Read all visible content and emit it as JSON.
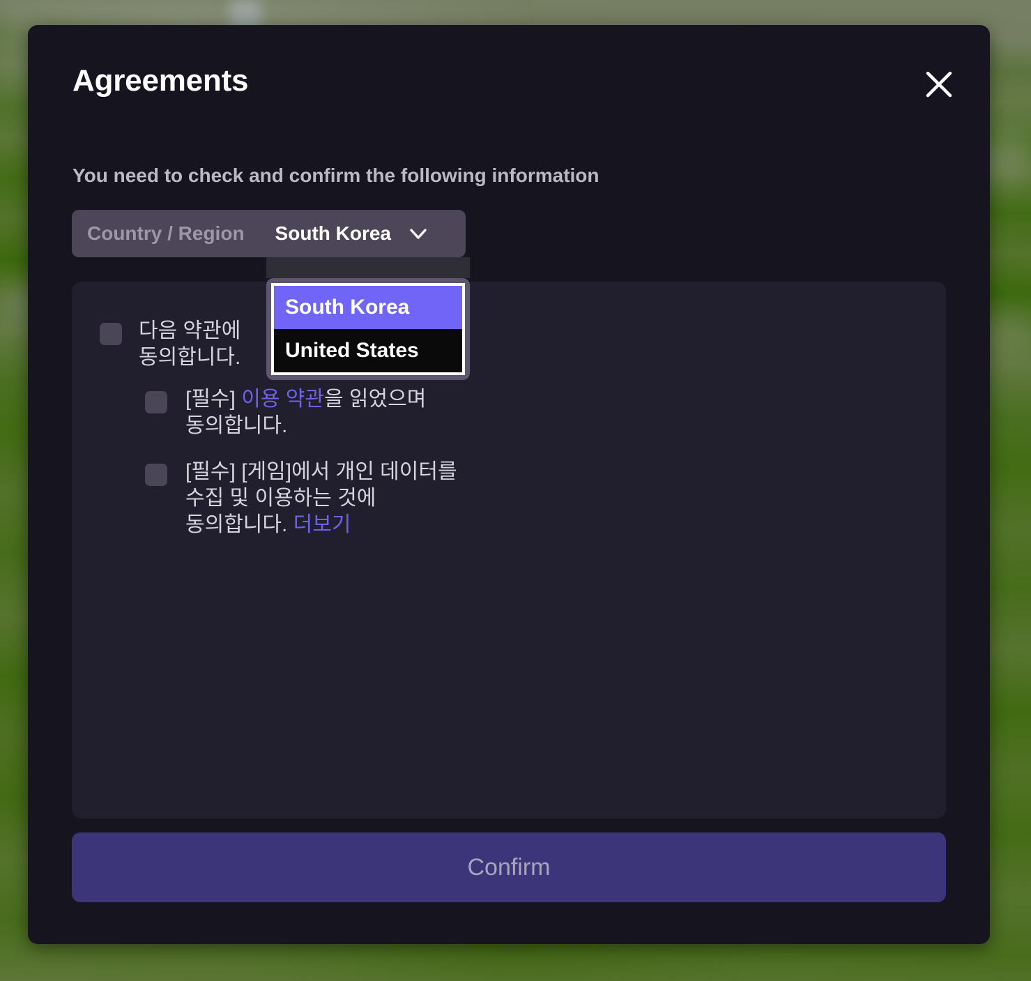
{
  "dialog": {
    "title": "Agreements",
    "subtitle": "You need to check and confirm the following information",
    "close_icon": "close-icon"
  },
  "country_select": {
    "label": "Country / Region",
    "value": "South Korea",
    "caret_icon": "chevron-down-icon",
    "expanded": true,
    "options": [
      {
        "label": "South Korea",
        "selected": true
      },
      {
        "label": "United States",
        "selected": false
      }
    ]
  },
  "agreements": [
    {
      "id": "agree-all",
      "checked": false,
      "text": "다음 약관에\n동의합니다.",
      "link_text": "",
      "link_position": ""
    },
    {
      "id": "agree-tos",
      "checked": false,
      "prefix": "[필수] ",
      "link_text": "이용 약관",
      "suffix": "을 읽었으며\n동의합니다."
    },
    {
      "id": "agree-data",
      "checked": false,
      "prefix": "[필수] [게임]에서 개인 데이터를\n수집 및 이용하는 것에\n동의합니다. ",
      "link_text": "더보기",
      "suffix": ""
    }
  ],
  "confirm": {
    "label": "Confirm"
  },
  "colors": {
    "modal_background": "#16151f",
    "panel_background": "#211e2e",
    "select_background": "#4d4658",
    "dropdown_highlight": "#7165f7",
    "dropdown_list_background": "#0a0a0a",
    "dropdown_frame": "#5d566c",
    "link": "#6c63e8",
    "checkbox": "#4b4558",
    "confirm_background": "#3c357a",
    "confirm_text": "#a9a5bd",
    "title_text": "#ffffff",
    "subtitle_text": "#b9bac3",
    "body_text": "#d6d4dd",
    "backdrop_green": "#4c7314"
  }
}
